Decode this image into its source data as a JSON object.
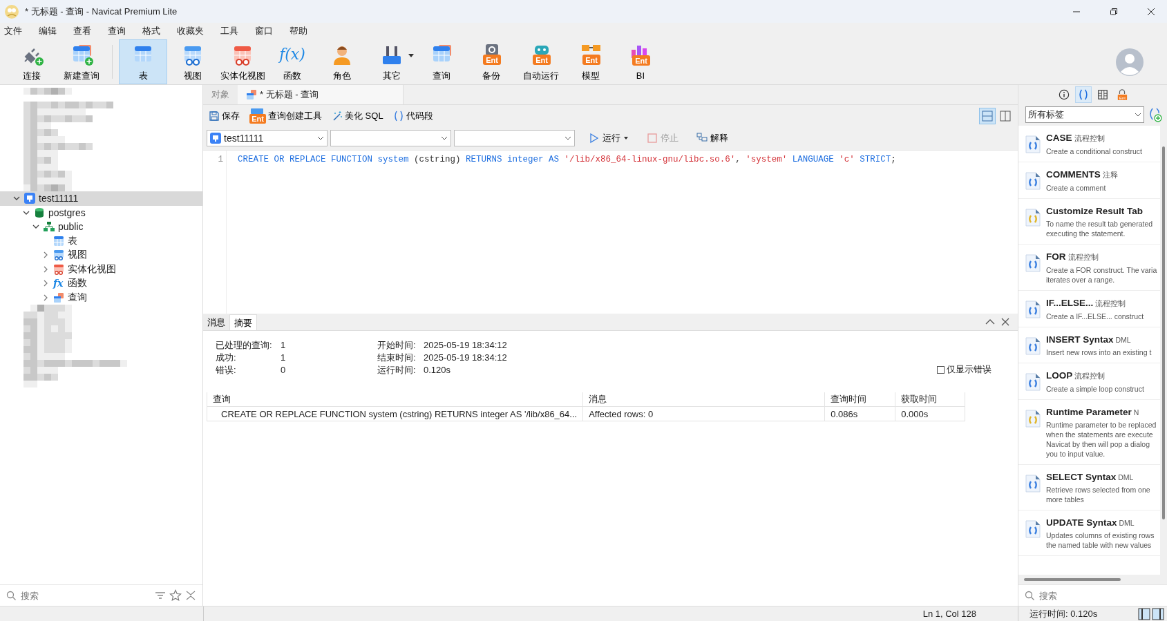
{
  "window": {
    "title": "* 无标题 - 查询 - Navicat Premium Lite"
  },
  "menu": [
    "文件",
    "编辑",
    "查看",
    "查询",
    "格式",
    "收藏夹",
    "工具",
    "窗口",
    "帮助"
  ],
  "toolbar": [
    {
      "label": "连接",
      "kind": "connect",
      "selected": false,
      "dropdown": false
    },
    {
      "label": "新建查询",
      "kind": "new-query",
      "selected": false,
      "dropdown": false
    },
    {
      "label": "表",
      "kind": "table",
      "selected": true,
      "dropdown": false
    },
    {
      "label": "视图",
      "kind": "view",
      "selected": false,
      "dropdown": false
    },
    {
      "label": "实体化视图",
      "kind": "matview",
      "selected": false,
      "dropdown": false
    },
    {
      "label": "函数",
      "kind": "function",
      "glyph": "f(x)",
      "selected": false,
      "dropdown": false
    },
    {
      "label": "角色",
      "kind": "role",
      "selected": false,
      "dropdown": false
    },
    {
      "label": "其它",
      "kind": "other",
      "selected": false,
      "dropdown": true
    },
    {
      "label": "查询",
      "kind": "query",
      "selected": false,
      "dropdown": false
    },
    {
      "label": "备份",
      "kind": "backup",
      "badge": "Ent",
      "selected": false,
      "dropdown": false
    },
    {
      "label": "自动运行",
      "kind": "robot",
      "badge": "Ent",
      "selected": false,
      "dropdown": false
    },
    {
      "label": "模型",
      "kind": "model",
      "badge": "Ent",
      "selected": false,
      "dropdown": false
    },
    {
      "label": "BI",
      "kind": "bi",
      "badge": "Ent",
      "selected": false,
      "dropdown": false
    }
  ],
  "tree": [
    {
      "label": "test11111",
      "kind": "connection",
      "selected": true,
      "expander": true,
      "expanded": true,
      "children": [
        {
          "label": "postgres",
          "kind": "database",
          "selected": false,
          "expander": true,
          "expanded": true,
          "children": [
            {
              "label": "public",
              "kind": "schema",
              "selected": false,
              "expander": true,
              "expanded": true,
              "children": [
                {
                  "label": "表",
                  "kind": "table",
                  "selected": false,
                  "expander": false,
                  "expanded": false
                },
                {
                  "label": "视图",
                  "kind": "view",
                  "selected": false,
                  "expander": true,
                  "expanded": false
                },
                {
                  "label": "实体化视图",
                  "kind": "matview",
                  "selected": false,
                  "expander": true,
                  "expanded": false
                },
                {
                  "label": "函数",
                  "kind": "function",
                  "glyph": "fx",
                  "selected": false,
                  "expander": true,
                  "expanded": false
                },
                {
                  "label": "查询",
                  "kind": "query",
                  "selected": false,
                  "expander": true,
                  "expanded": false
                }
              ]
            }
          ]
        }
      ]
    }
  ],
  "sidebar_search": {
    "placeholder": "搜索"
  },
  "editor_tabs": [
    {
      "label": "对象",
      "selected": false
    },
    {
      "label": "* 无标题 - 查询",
      "selected": true
    }
  ],
  "editor_toolbar": [
    {
      "label": "保存",
      "kind": "save"
    },
    {
      "label": "查询创建工具",
      "kind": "builder",
      "badge": "Ent"
    },
    {
      "label": "美化 SQL",
      "kind": "beautify"
    },
    {
      "label": "代码段",
      "kind": "snippet"
    }
  ],
  "layout_toggles": [
    {
      "kind": "split-h",
      "selected": true
    },
    {
      "kind": "split-v",
      "selected": false
    }
  ],
  "selectors": [
    {
      "value": "test11111",
      "kind": "connection"
    },
    {
      "kind": "empty"
    },
    {
      "kind": "empty"
    }
  ],
  "run_controls": [
    {
      "label": "运行",
      "kind": "run",
      "disabled": false,
      "dropdown": true
    },
    {
      "label": "停止",
      "kind": "stop",
      "disabled": true,
      "dropdown": false
    },
    {
      "label": "解释",
      "kind": "explain",
      "disabled": false,
      "dropdown": false
    }
  ],
  "code": [
    {
      "number": "1",
      "tokens": [
        {
          "text": "CREATE OR REPLACE FUNCTION system",
          "kind": "keyword"
        },
        {
          "text": " (cstring) ",
          "kind": "plain"
        },
        {
          "text": "RETURNS integer AS ",
          "kind": "keyword"
        },
        {
          "text": "'/lib/x86_64-linux-gnu/libc.so.6'",
          "kind": "string"
        },
        {
          "text": ", ",
          "kind": "plain"
        },
        {
          "text": "'system'",
          "kind": "string"
        },
        {
          "text": " LANGUAGE ",
          "kind": "keyword"
        },
        {
          "text": "'c'",
          "kind": "string"
        },
        {
          "text": " STRICT",
          "kind": "keyword"
        },
        {
          "text": ";",
          "kind": "plain"
        }
      ]
    }
  ],
  "result_tabs": [
    {
      "label": "消息",
      "selected": false
    },
    {
      "label": "摘要",
      "selected": true
    }
  ],
  "summary": {
    "left": [
      {
        "label": "已处理的查询:",
        "value": "1"
      },
      {
        "label": "成功:",
        "value": "1"
      },
      {
        "label": "错误:",
        "value": "0"
      }
    ],
    "right": [
      {
        "label": "开始时间:",
        "value": "2025-05-19 18:34:12"
      },
      {
        "label": "结束时间:",
        "value": "2025-05-19 18:34:12"
      },
      {
        "label": "运行时间:",
        "value": "0.120s"
      }
    ],
    "errors_only": {
      "label": "仅显示错误",
      "checked": false
    }
  },
  "result_table": {
    "columns": [
      "查询",
      "消息",
      "查询时间",
      "获取时间"
    ],
    "rows": [
      [
        "CREATE OR REPLACE FUNCTION system (cstring) RETURNS integer AS '/lib/x86_64...",
        "Affected rows: 0",
        "0.086s",
        "0.000s"
      ]
    ]
  },
  "right_panel": {
    "tabs": [
      {
        "kind": "info",
        "selected": false
      },
      {
        "kind": "snippet",
        "selected": true
      },
      {
        "kind": "columns",
        "selected": false
      },
      {
        "kind": "ent",
        "badge": "Ent",
        "selected": false
      }
    ],
    "filter": {
      "value": "所有标签"
    },
    "snippets": [
      {
        "title": "CASE",
        "tag": "流程控制",
        "description": "Create a conditional construct",
        "color": "#3a7fe0"
      },
      {
        "title": "COMMENTS",
        "tag": "注释",
        "description": "Create a comment",
        "color": "#3a7fe0"
      },
      {
        "title": "Customize Result Tab",
        "description": "To name the result tab generated executing the statement.",
        "color": "#e0b528"
      },
      {
        "title": "FOR",
        "tag": "流程控制",
        "description": "Create a FOR construct. The varia iterates over a range.",
        "color": "#3a7fe0"
      },
      {
        "title": "IF...ELSE...",
        "tag": "流程控制",
        "description": "Create a IF...ELSE... construct",
        "color": "#3a7fe0"
      },
      {
        "title": "INSERT Syntax",
        "tag": "DML",
        "description": "Insert new rows into an existing t",
        "color": "#3a7fe0"
      },
      {
        "title": "LOOP",
        "tag": "流程控制",
        "description": "Create a simple loop construct",
        "color": "#3a7fe0"
      },
      {
        "title": "Runtime Parameter",
        "tag": "N",
        "description": "Runtime parameter to be replaced when the statements are execute Navicat by then will pop a dialog you to input value.",
        "color": "#e0b528"
      },
      {
        "title": "SELECT Syntax",
        "tag": "DML",
        "description": "Retrieve rows selected from one more tables",
        "color": "#3a7fe0"
      },
      {
        "title": "UPDATE Syntax",
        "tag": "DML",
        "description": "Updates columns of existing rows the named table with new values",
        "color": "#3a7fe0"
      }
    ],
    "search": {
      "placeholder": "搜索"
    }
  },
  "status_bar": {
    "position": "Ln 1, Col 128",
    "run_time": "运行时间: 0.120s"
  }
}
